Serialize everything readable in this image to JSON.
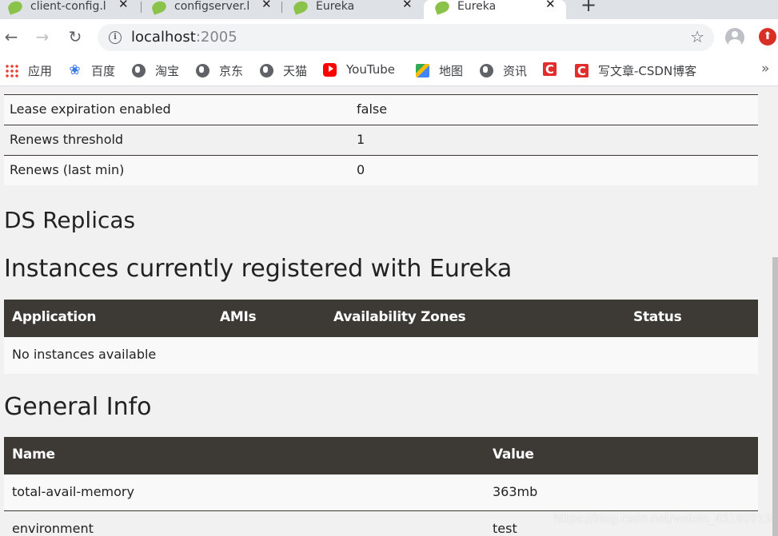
{
  "tabs": [
    {
      "label": "client-config.l",
      "close": "✕"
    },
    {
      "label": "configserver.l",
      "close": "✕"
    },
    {
      "label": "Eureka",
      "close": "✕"
    },
    {
      "label": "Eureka",
      "close": "✕"
    }
  ],
  "new_tab_label": "+",
  "toolbar": {
    "back_icon": "←",
    "forward_icon": "→",
    "reload_icon": "↻",
    "info_icon": "i",
    "star_icon": "☆",
    "url_host": "localhost",
    "url_port": ":2005",
    "extension_icon": "⬆"
  },
  "bookmarks": [
    {
      "label": "应用",
      "icon": "apps-icon"
    },
    {
      "label": "百度",
      "icon": "baidu-paw-icon"
    },
    {
      "label": "淘宝",
      "icon": "globe-icon"
    },
    {
      "label": "京东",
      "icon": "globe-icon"
    },
    {
      "label": "天猫",
      "icon": "globe-icon"
    },
    {
      "label": "YouTube",
      "icon": "youtube-icon"
    },
    {
      "label": "地图",
      "icon": "maps-icon"
    },
    {
      "label": "资讯",
      "icon": "globe-icon"
    },
    {
      "label": "",
      "icon": "csdn-icon"
    },
    {
      "label": "写文章-CSDN博客",
      "icon": "csdn-icon"
    }
  ],
  "bookmarks_more": "»",
  "lease_rows": [
    {
      "name": "Lease expiration enabled",
      "value": "false"
    },
    {
      "name": "Renews threshold",
      "value": "1"
    },
    {
      "name": "Renews (last min)",
      "value": "0"
    }
  ],
  "headings": {
    "replicas": "DS Replicas",
    "instances": "Instances currently registered with Eureka",
    "general": "General Info"
  },
  "instances_table": {
    "headers": [
      "Application",
      "AMIs",
      "Availability Zones",
      "Status"
    ],
    "empty_text": "No instances available"
  },
  "general_table": {
    "headers": [
      "Name",
      "Value"
    ],
    "rows": [
      {
        "name": "total-avail-memory",
        "value": "363mb"
      },
      {
        "name": "environment",
        "value": "test"
      }
    ]
  },
  "watermark": "https://blog.csdn.net/weixin_45180919"
}
